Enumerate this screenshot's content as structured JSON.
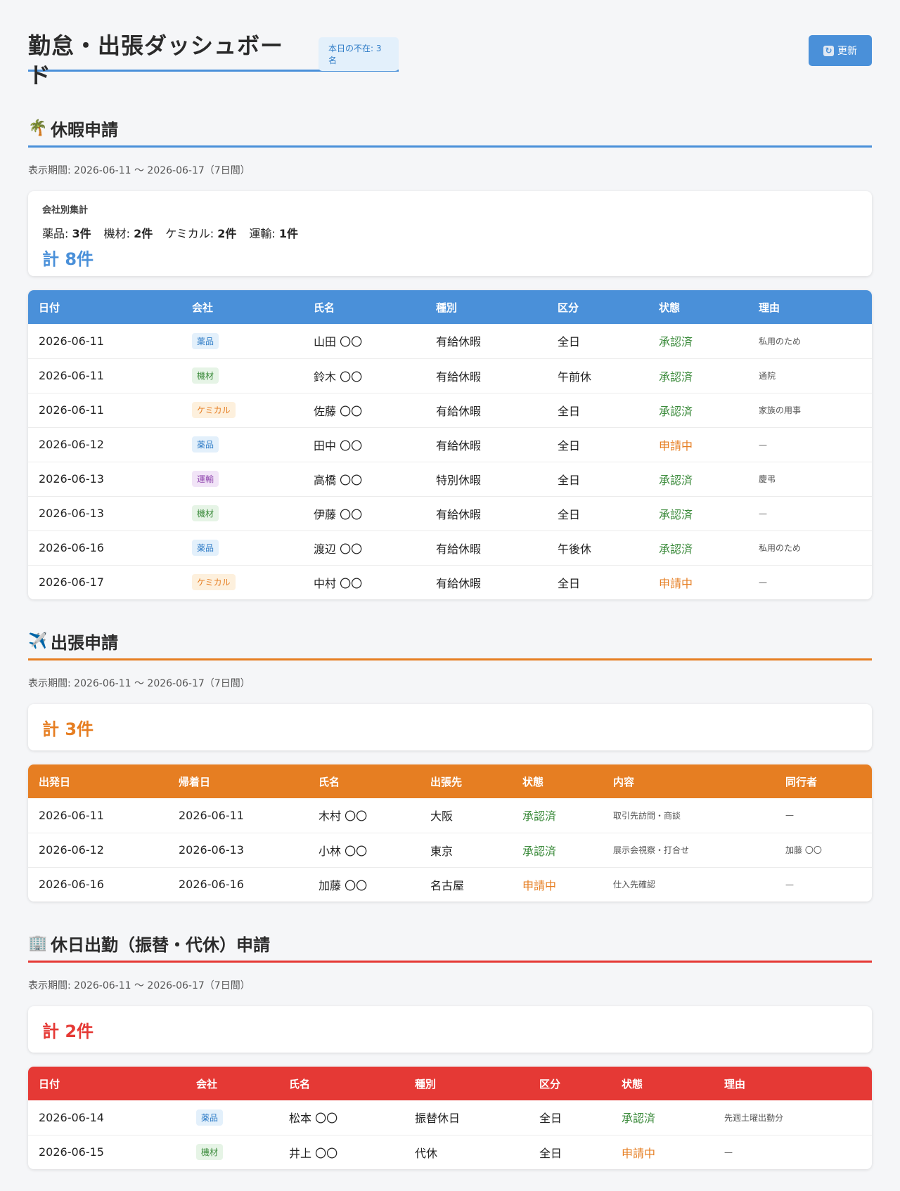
{
  "header": {
    "title": "勤怠・出張ダッシュボード",
    "absent_badge": "本日の不在: 3名",
    "refresh_label": "更新"
  },
  "colors": {
    "leave": "#4a90d9",
    "trip": "#e67e22",
    "holiday": "#e53935",
    "approved": "#3a8a3a",
    "pending": "#e67e22"
  },
  "leave": {
    "icon": "palm-tree-icon",
    "title": "休暇申請",
    "period": "表示期間: 2026-06-11 〜 2026-06-17（7日間）",
    "summary_caption": "会社別集計",
    "breakdown": [
      {
        "label": "薬品:",
        "count": "3件"
      },
      {
        "label": "機材:",
        "count": "2件"
      },
      {
        "label": "ケミカル:",
        "count": "2件"
      },
      {
        "label": "運輸:",
        "count": "1件"
      }
    ],
    "total": "計 8件",
    "columns": [
      "日付",
      "会社",
      "氏名",
      "種別",
      "区分",
      "状態",
      "理由"
    ],
    "rows": [
      {
        "date": "2026-06-11",
        "company": "薬品",
        "name": "山田 〇〇",
        "type": "有給休暇",
        "division": "全日",
        "status": "承認済",
        "reason": "私用のため"
      },
      {
        "date": "2026-06-11",
        "company": "機材",
        "name": "鈴木 〇〇",
        "type": "有給休暇",
        "division": "午前休",
        "status": "承認済",
        "reason": "通院"
      },
      {
        "date": "2026-06-11",
        "company": "ケミカル",
        "name": "佐藤 〇〇",
        "type": "有給休暇",
        "division": "全日",
        "status": "承認済",
        "reason": "家族の用事"
      },
      {
        "date": "2026-06-12",
        "company": "薬品",
        "name": "田中 〇〇",
        "type": "有給休暇",
        "division": "全日",
        "status": "申請中",
        "reason": "—"
      },
      {
        "date": "2026-06-13",
        "company": "運輸",
        "name": "高橋 〇〇",
        "type": "特別休暇",
        "division": "全日",
        "status": "承認済",
        "reason": "慶弔"
      },
      {
        "date": "2026-06-13",
        "company": "機材",
        "name": "伊藤 〇〇",
        "type": "有給休暇",
        "division": "全日",
        "status": "承認済",
        "reason": "—"
      },
      {
        "date": "2026-06-16",
        "company": "薬品",
        "name": "渡辺 〇〇",
        "type": "有給休暇",
        "division": "午後休",
        "status": "承認済",
        "reason": "私用のため"
      },
      {
        "date": "2026-06-17",
        "company": "ケミカル",
        "name": "中村 〇〇",
        "type": "有給休暇",
        "division": "全日",
        "status": "申請中",
        "reason": "—"
      }
    ]
  },
  "trip": {
    "icon": "airplane-icon",
    "title": "出張申請",
    "period": "表示期間: 2026-06-11 〜 2026-06-17（7日間）",
    "total": "計 3件",
    "columns": [
      "出発日",
      "帰着日",
      "氏名",
      "出張先",
      "状態",
      "内容",
      "同行者"
    ],
    "rows": [
      {
        "depart": "2026-06-11",
        "return": "2026-06-11",
        "name": "木村 〇〇",
        "destination": "大阪",
        "status": "承認済",
        "content": "取引先訪問・商談",
        "companion": "—"
      },
      {
        "depart": "2026-06-12",
        "return": "2026-06-13",
        "name": "小林 〇〇",
        "destination": "東京",
        "status": "承認済",
        "content": "展示会視察・打合せ",
        "companion": "加藤 〇〇"
      },
      {
        "depart": "2026-06-16",
        "return": "2026-06-16",
        "name": "加藤 〇〇",
        "destination": "名古屋",
        "status": "申請中",
        "content": "仕入先確認",
        "companion": "—"
      }
    ]
  },
  "holiday": {
    "icon": "office-building-icon",
    "title": "休日出勤（振替・代休）申請",
    "period": "表示期間: 2026-06-11 〜 2026-06-17（7日間）",
    "total": "計 2件",
    "columns": [
      "日付",
      "会社",
      "氏名",
      "種別",
      "区分",
      "状態",
      "理由"
    ],
    "rows": [
      {
        "date": "2026-06-14",
        "company": "薬品",
        "name": "松本 〇〇",
        "type": "振替休日",
        "division": "全日",
        "status": "承認済",
        "reason": "先週土曜出勤分"
      },
      {
        "date": "2026-06-15",
        "company": "機材",
        "name": "井上 〇〇",
        "type": "代休",
        "division": "全日",
        "status": "申請中",
        "reason": "—"
      }
    ]
  },
  "company_badges": {
    "薬品": {
      "bg": "#e3f0fb",
      "fg": "#2f7cc7"
    },
    "機材": {
      "bg": "#e6f4e6",
      "fg": "#3a8a3a"
    },
    "ケミカル": {
      "bg": "#fdf0dd",
      "fg": "#e67e22"
    },
    "運輸": {
      "bg": "#f1e4f7",
      "fg": "#8e44ad"
    }
  }
}
